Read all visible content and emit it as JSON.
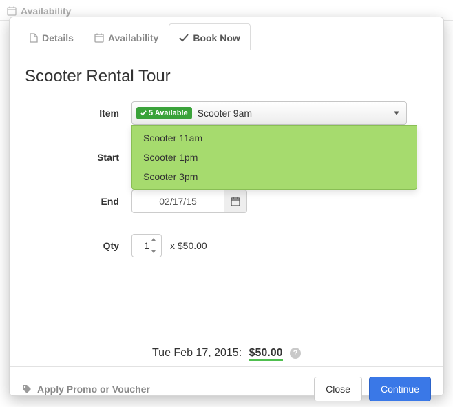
{
  "background": {
    "availability_label": "Availability"
  },
  "tabs": {
    "details": "Details",
    "availability": "Availability",
    "book_now": "Book Now"
  },
  "title": "Scooter Rental Tour",
  "form": {
    "item_label": "Item",
    "item_available_badge": "5 Available",
    "item_selected": "Scooter 9am",
    "item_options": [
      "Scooter 11am",
      "Scooter 1pm",
      "Scooter 3pm"
    ],
    "start_label": "Start",
    "end_label": "End",
    "end_date": "02/17/15",
    "qty_label": "Qty",
    "qty_value": "1",
    "unit_price_label": "x $50.00"
  },
  "summary": {
    "date_text": "Tue Feb 17, 2015:",
    "total": "$50.00"
  },
  "footer": {
    "promo_label": "Apply Promo or Voucher",
    "close": "Close",
    "continue": "Continue"
  }
}
